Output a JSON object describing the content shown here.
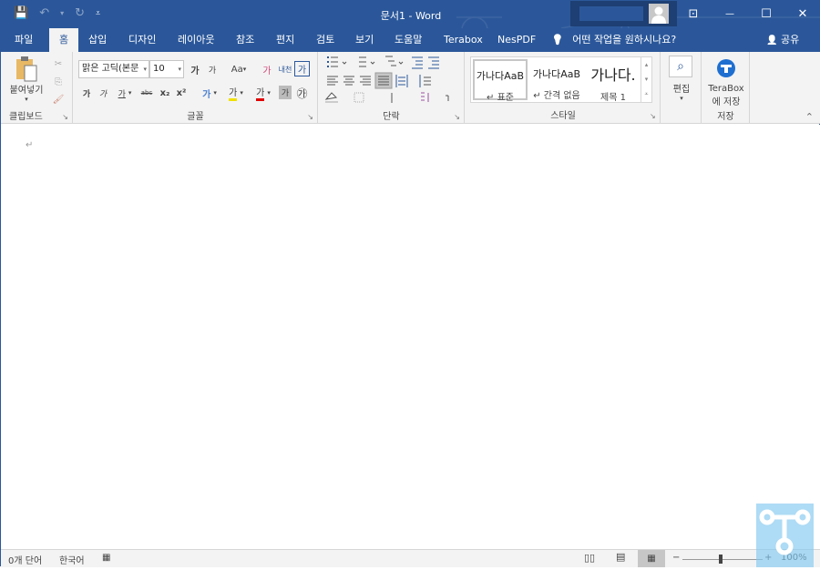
{
  "title_bar": {
    "title": "문서1  -  Word",
    "qat": {
      "save_icon": "💾",
      "undo_icon": "↶",
      "undo_arrow": "▾",
      "redo_icon": "↻",
      "customize_icon": "⩡"
    },
    "window_buttons": {
      "ribbon_display": "⊡",
      "minimize": "—",
      "maximize": "☐",
      "close": "✕"
    }
  },
  "tabs": [
    {
      "label": "파일"
    },
    {
      "label": "홈"
    },
    {
      "label": "삽입"
    },
    {
      "label": "디자인"
    },
    {
      "label": "레이아웃"
    },
    {
      "label": "참조"
    },
    {
      "label": "편지"
    },
    {
      "label": "검토"
    },
    {
      "label": "보기"
    },
    {
      "label": "도움말"
    },
    {
      "label": "Terabox"
    },
    {
      "label": "NesPDF"
    }
  ],
  "tell_me": {
    "icon": "💡",
    "placeholder": "어떤 작업을 원하시나요?"
  },
  "share": {
    "icon": "👤",
    "label": "공유"
  },
  "ribbon": {
    "clipboard": {
      "label": "클립보드",
      "paste_label": "붙여넣기",
      "paste_arrow": "▾",
      "cut_icon": "✂",
      "copy_icon": "⎘",
      "format_painter_icon": "🖌",
      "launcher": "↘"
    },
    "font": {
      "label": "글꼴",
      "font_name": "맑은 고딕(본문",
      "font_size": "10",
      "launcher": "↘",
      "grow": "가",
      "shrink": "가",
      "change_case": "Aa",
      "clear_format": "가",
      "phonetic": "내천",
      "char_border": "가",
      "bold": "가",
      "italic": "가",
      "underline": "가",
      "strike": "abc",
      "subscript": "x₂",
      "superscript": "x²",
      "text_effects": "가",
      "highlight": "가",
      "font_color": "가",
      "char_shading": "가",
      "enclose": "㉮"
    },
    "paragraph": {
      "label": "단락",
      "launcher": "↘"
    },
    "styles": {
      "label": "스타일",
      "launcher": "↘",
      "items": [
        {
          "preview": "가나다AaB",
          "name": "↵ 표준"
        },
        {
          "preview": "가나다AaB",
          "name": "↵ 간격 없음"
        },
        {
          "preview": "가나다.",
          "name": "제목 1"
        }
      ]
    },
    "editing": {
      "label": "편집",
      "icon": "⌕",
      "arrow": "▾"
    },
    "terabox": {
      "label_line1": "TeraBox",
      "label_line2": "에 저장",
      "group_label": "저장"
    },
    "collapse_icon": "⌃"
  },
  "document": {
    "pilcrow": "↵"
  },
  "status_bar": {
    "word_count": "0개 단어",
    "language": "한국어",
    "macro_icon": "▦",
    "zoom_minus": "−",
    "zoom_plus": "+",
    "zoom_level": "100%",
    "zoom_percent": 100
  }
}
